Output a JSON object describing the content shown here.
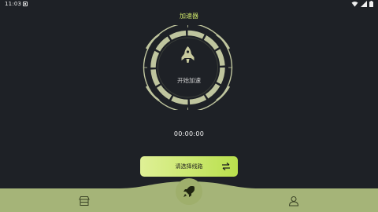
{
  "status_bar": {
    "time": "11:03"
  },
  "app_title": "加速器",
  "dial": {
    "start_label": "开始加速"
  },
  "timer": "00:00:00",
  "route_button": {
    "label": "请选择线路"
  },
  "colors": {
    "background": "#1e2126",
    "accent": "#cbe36a",
    "nav_bar": "#a5b478",
    "dial_ring": "#bfc59e"
  }
}
